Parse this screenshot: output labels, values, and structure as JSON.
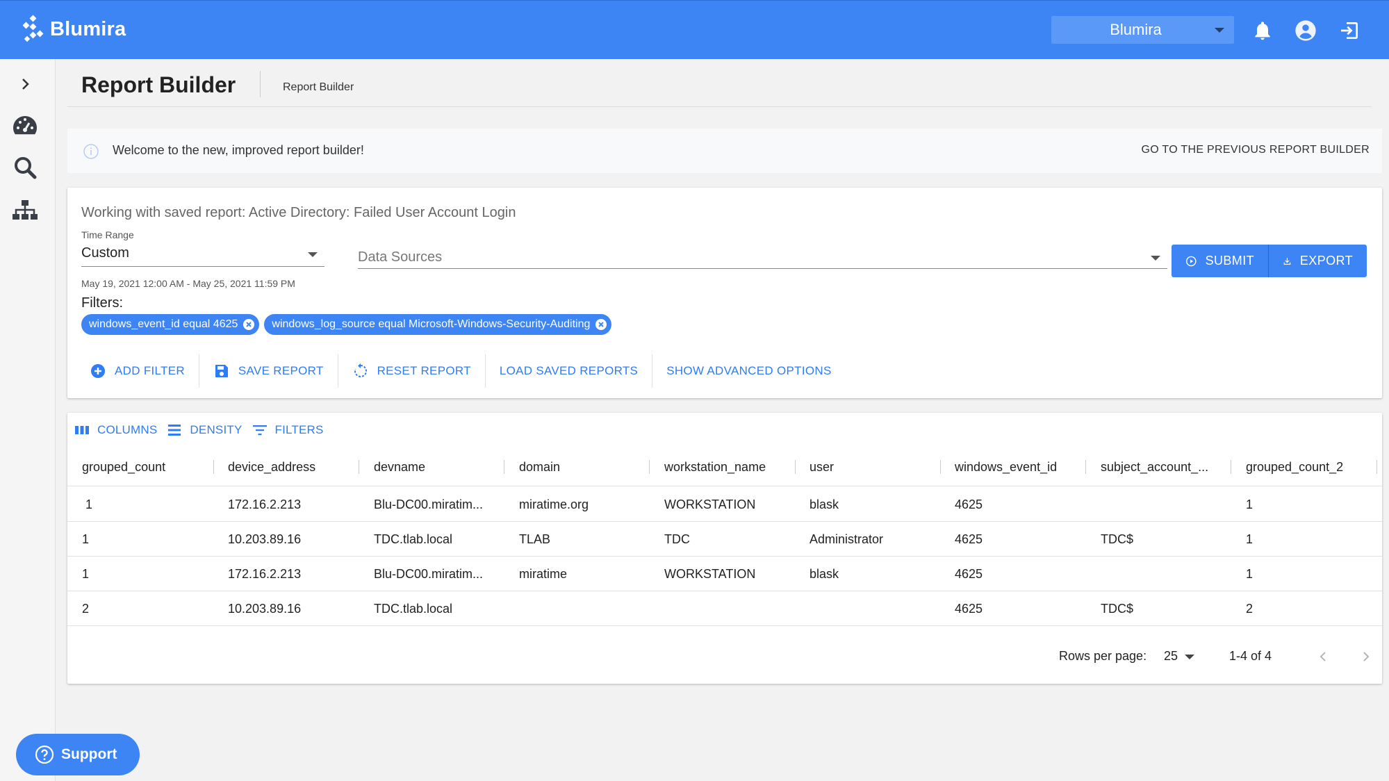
{
  "app": {
    "brand_name": "Blumira",
    "org_selector_value": "Blumira",
    "accent_color": "#3d85f5"
  },
  "header_icons": [
    "bell-icon",
    "user-icon",
    "logout-icon"
  ],
  "sidebar": {
    "items": [
      {
        "icon": "chevron-right-icon"
      },
      {
        "icon": "dashboard-gauge-icon"
      },
      {
        "icon": "search-icon"
      },
      {
        "icon": "sitemap-icon"
      }
    ]
  },
  "page": {
    "title": "Report Builder",
    "breadcrumb": "Report Builder"
  },
  "banner": {
    "message": "Welcome to the new, improved report builder!",
    "link": "GO TO THE PREVIOUS REPORT BUILDER"
  },
  "report": {
    "working_with": "Working with saved report: Active Directory: Failed User Account Login",
    "time_range_label": "Time Range",
    "time_range_value": "Custom",
    "date_range": "May 19, 2021 12:00 AM - May 25, 2021 11:59 PM",
    "data_sources_placeholder": "Data Sources",
    "submit_label": "SUBMIT",
    "export_label": "EXPORT",
    "filters_label": "Filters:",
    "filters": [
      "windows_event_id equal 4625",
      "windows_log_source equal Microsoft-Windows-Security-Auditing"
    ],
    "actions": {
      "add_filter": "ADD FILTER",
      "save_report": "SAVE REPORT",
      "reset_report": "RESET REPORT",
      "load_saved": "LOAD SAVED REPORTS",
      "advanced": "SHOW ADVANCED OPTIONS"
    }
  },
  "grid": {
    "toolbar": {
      "columns": "COLUMNS",
      "density": "DENSITY",
      "filters": "FILTERS"
    },
    "columns": [
      "grouped_count",
      "device_address",
      "devname",
      "domain",
      "workstation_name",
      "user",
      "windows_event_id",
      "subject_account_...",
      "grouped_count_2"
    ],
    "rows": [
      [
        "1",
        "172.16.2.213",
        "Blu-DC00.miratim...",
        "miratime.org",
        "WORKSTATION",
        "blask",
        "4625",
        "",
        "1"
      ],
      [
        "1",
        "10.203.89.16",
        "TDC.tlab.local",
        "TLAB",
        "TDC",
        "Administrator",
        "4625",
        "TDC$",
        "1"
      ],
      [
        "1",
        "172.16.2.213",
        "Blu-DC00.miratim...",
        "miratime",
        "WORKSTATION",
        "blask",
        "4625",
        "",
        "1"
      ],
      [
        "2",
        "10.203.89.16",
        "TDC.tlab.local",
        "",
        "",
        "",
        "4625",
        "TDC$",
        "2"
      ]
    ],
    "rows_per_page_label": "Rows per page:",
    "rows_per_page": "25",
    "range_text": "1-4 of 4"
  },
  "support_label": "Support"
}
